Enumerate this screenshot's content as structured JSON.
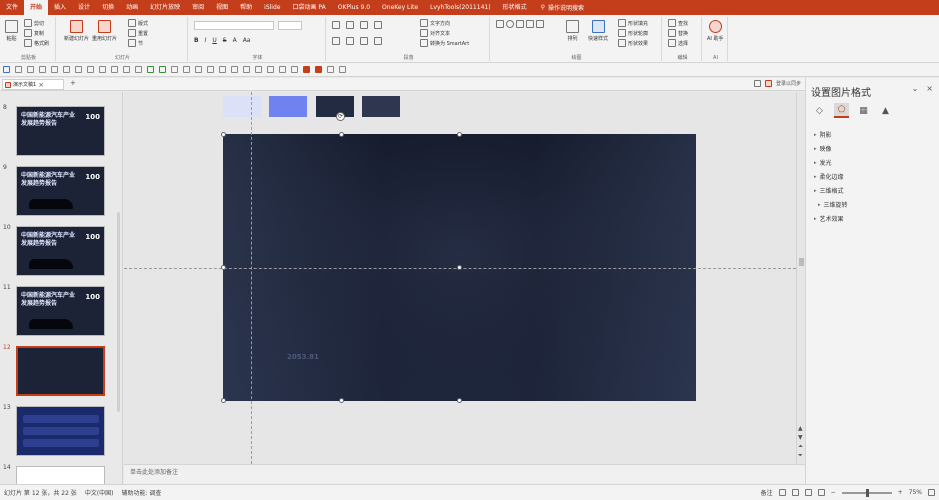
{
  "ribbon_tabs": [
    "文件",
    "开始",
    "插入",
    "设计",
    "切换",
    "动画",
    "幻灯片放映",
    "审阅",
    "视图",
    "帮助",
    "iSlide",
    "口袋动画 PA",
    "OKPlus 9.0",
    "OneKey Lite",
    "LvyhTools(2011141)",
    "形状格式"
  ],
  "active_tab_index": 1,
  "tell_me": "操作说明搜索",
  "ribbon_groups": {
    "clipboard": {
      "name": "剪贴板",
      "paste": "粘贴",
      "cut": "剪切",
      "copy": "复制",
      "format_painter": "格式刷"
    },
    "slides": {
      "name": "幻灯片",
      "new_slide": "新建幻灯片",
      "reuse": "重用幻灯片",
      "layout": "版式",
      "reset": "重置",
      "section": "节"
    },
    "font": {
      "name": "字体"
    },
    "paragraph": {
      "name": "段落",
      "text_direction": "文字方向",
      "align_text": "对齐文本",
      "convert_smartart": "转换为 SmartArt"
    },
    "drawing": {
      "name": "绘图",
      "arrange": "排列",
      "quick_styles": "快速样式",
      "shape_fill": "形状填充",
      "shape_outline": "形状轮廓",
      "shape_effects": "形状效果"
    },
    "editing": {
      "name": "编辑",
      "find": "查找",
      "replace": "替换",
      "select": "选择"
    },
    "ai": {
      "name": "AI",
      "label": "AI 助手"
    }
  },
  "doc_tab": {
    "title": "演示文稿1",
    "right_label": "登录以同步"
  },
  "slides": [
    {
      "num": "8",
      "title": "中国新能源汽车产业 发展趋势报告",
      "badge": "100"
    },
    {
      "num": "9",
      "title": "中国新能源汽车产业 发展趋势报告",
      "badge": "100"
    },
    {
      "num": "10",
      "title": "中国新能源汽车产业 发展趋势报告",
      "badge": "100"
    },
    {
      "num": "11",
      "title": "中国新能源汽车产业 发展趋势报告",
      "badge": "100"
    },
    {
      "num": "12",
      "title": "",
      "badge": ""
    },
    {
      "num": "13",
      "title": "",
      "badge": ""
    },
    {
      "num": "14",
      "title": "",
      "badge": ""
    }
  ],
  "selected_slide_index": 4,
  "canvas": {
    "swatches": [
      "#dde1f7",
      "#6f82f0",
      "#232b42",
      "#2e3650"
    ],
    "bg_number": "2053.81",
    "rotate_glyph": "⟳"
  },
  "notes_placeholder": "单击此处添加备注",
  "format_pane": {
    "title": "设置图片格式",
    "close": "×",
    "collapse": "⌄",
    "sections": [
      "阴影",
      "映像",
      "发光",
      "柔化边缘",
      "三维格式",
      "三维旋转",
      "艺术效果"
    ]
  },
  "status": {
    "slide_pos": "幻灯片 第 12 张，共 22 张",
    "language": "中文(中国)",
    "accessibility": "辅助功能: 调查",
    "notes": "备注",
    "zoom": "75%"
  }
}
